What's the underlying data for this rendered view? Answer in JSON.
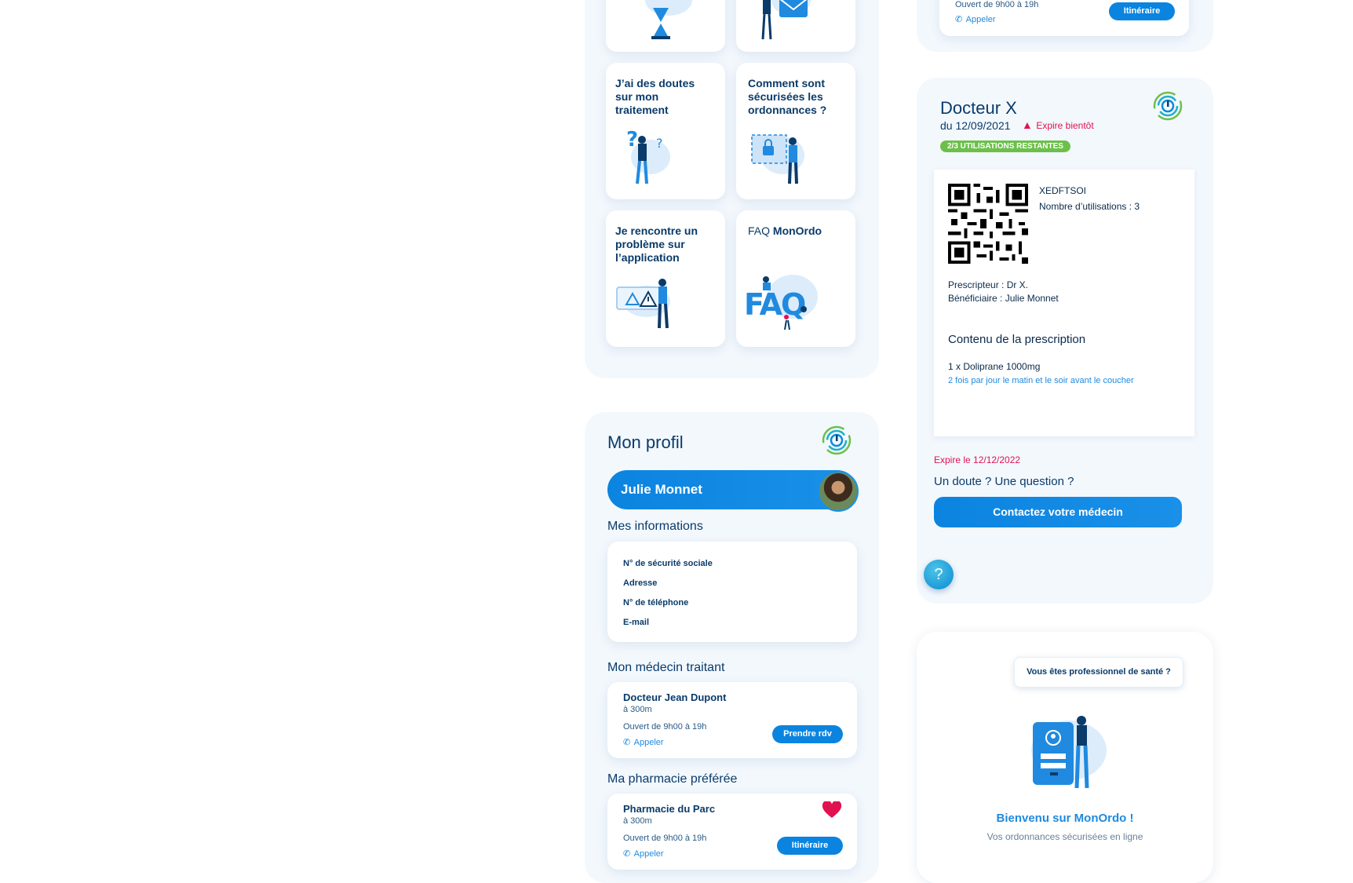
{
  "colors": {
    "accent": "#0b84e0",
    "dark": "#0a3b6a",
    "alert": "#e0124f",
    "green": "#6cc04a",
    "panel": "#f3f8fd"
  },
  "top_partial_card": {
    "hours": "Ouvert de 9h00 à 19h",
    "call": "Appeler",
    "button": "Itinéraire"
  },
  "help_tiles": [
    {
      "title": "J’ai des doutes sur mon traitement"
    },
    {
      "title": "Comment sont sécurisées les ordonnances ?"
    },
    {
      "title": "Je rencontre un problème sur l’application"
    },
    {
      "title_prefix": "FAQ ",
      "title_brand": "MonOrdo",
      "faq_text": "FAQ"
    }
  ],
  "profile": {
    "title": "Mon profil",
    "user_name": "Julie Monnet",
    "info_section": "Mes informations",
    "info_fields": [
      "N° de sécurité sociale",
      "Adresse",
      "N° de téléphone",
      "E-mail"
    ],
    "doctor_section": "Mon médecin traitant",
    "doctor": {
      "name": "Docteur Jean Dupont",
      "distance": "à 300m",
      "hours": "Ouvert de 9h00 à 19h",
      "call": "Appeler",
      "button": "Prendre rdv"
    },
    "pharmacy_section": "Ma pharmacie préférée",
    "pharmacy": {
      "name": "Pharmacie du Parc",
      "distance": "à 300m",
      "hours": "Ouvert de 9h00 à 19h",
      "call": "Appeler",
      "button": "Itinéraire"
    }
  },
  "prescription": {
    "doctor": "Docteur X",
    "date": "du 12/09/2021",
    "warning": "Expire bientôt",
    "badge": "2/3 UTILISATIONS RESTANTES",
    "code": "XEDFTSOI",
    "uses": "Nombre d’utilisations : 3",
    "prescriber": "Prescripteur : Dr X.",
    "beneficiary": "Bénéficiaire : Julie Monnet",
    "content_title": "Contenu de la prescription",
    "item": "1 x Doliprane 1000mg",
    "instructions": "2 fois par jour le matin et le soir avant le coucher",
    "expires": "Expire le 12/12/2022",
    "question": "Un doute ? Une question ?",
    "contact_button": "Contactez votre médecin",
    "help_icon": "?"
  },
  "welcome": {
    "pro_button": "Vous êtes professionnel de santé ?",
    "title": "Bienvenu sur MonOrdo !",
    "subtitle": "Vos ordonnances sécurisées en ligne"
  }
}
